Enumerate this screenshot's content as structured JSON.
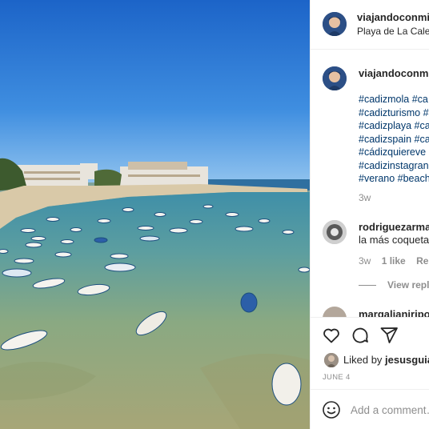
{
  "post": {
    "author": "viajandoconmiri",
    "location": "Playa de La Caleta"
  },
  "caption": {
    "author": "viajandoconmiri",
    "hashtags": [
      "#cadizmola #ca",
      "#cadizturismo #",
      "#cadizplaya #ca",
      "#cadizspain #ca",
      "#cádizquiereve",
      "#cadizinstagran",
      "#verano #beach"
    ],
    "time": "3w"
  },
  "comments": [
    {
      "author": "rodriguezarmai",
      "text": "la más coqueta",
      "time": "3w",
      "likes": "1 like",
      "reply": "Reply",
      "view_replies": "View repli"
    },
    {
      "author": "margalianiripol"
    }
  ],
  "actions": {
    "icons": [
      "heart-icon",
      "comment-icon",
      "share-icon"
    ],
    "liked_by_prefix": "Liked by ",
    "liked_by_user": "jesusguia",
    "date": "JUNE 4"
  },
  "add_comment": {
    "placeholder": "Add a comment…",
    "emoji_icon": "smiley-icon"
  },
  "colors": {
    "hashtag": "#00376b",
    "muted": "#8e8e8e",
    "text": "#262626",
    "divider": "#efefef"
  }
}
